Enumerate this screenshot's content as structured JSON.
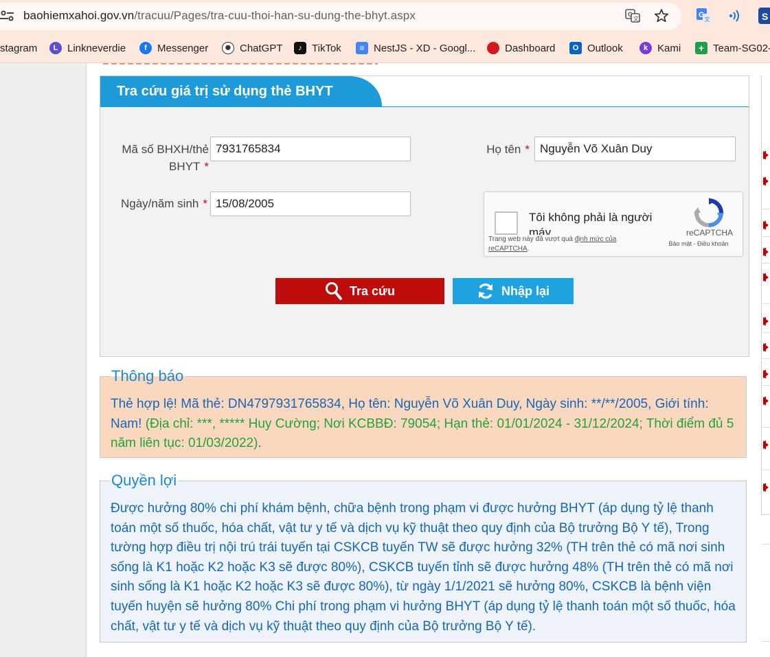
{
  "browser": {
    "url_host": "baohiemxahoi.gov.vn",
    "url_path": "/tracuu/Pages/tra-cuu-thoi-han-su-dung-the-bhyt.aspx",
    "icons": [
      "site-settings-icon",
      "translate-icon",
      "star-icon",
      "google-translate-extension-icon",
      "read-aloud-extension-icon",
      "extension-icon"
    ]
  },
  "bookmarks": [
    {
      "label": "stagram",
      "icon": "instagram-icon"
    },
    {
      "label": "Linkneverdie",
      "icon": "L"
    },
    {
      "label": "Messenger",
      "icon": "messenger-icon"
    },
    {
      "label": "ChatGPT",
      "icon": "chatgpt-icon"
    },
    {
      "label": "TikTok",
      "icon": "tiktok-icon"
    },
    {
      "label": "NestJS - XD - Googl...",
      "icon": "google-docs-icon"
    },
    {
      "label": "Dashboard",
      "icon": "dashboard-icon"
    },
    {
      "label": "Outlook",
      "icon": "outlook-icon"
    },
    {
      "label": "Kami",
      "icon": "k"
    },
    {
      "label": "Team-SG02-",
      "icon": "google-sheets-icon"
    }
  ],
  "form": {
    "title": "Tra cứu giá trị sử dụng thẻ BHYT",
    "card_label_1": "Mã số BHXH/thẻ",
    "card_label_2": "BHYT",
    "card_value": "7931765834",
    "name_label": "Họ tên",
    "name_value": "Nguyễn Võ Xuân Duy",
    "dob_label": "Ngày/năm sinh",
    "dob_value": "15/08/2005",
    "required_mark": "*",
    "search_button": "Tra cứu",
    "reset_button": "Nhập lại"
  },
  "captcha": {
    "label": "Tôi không phải là người máy",
    "notice_prefix": "Trang web này đã vượt quá",
    "notice_link": "định mức của reCAPTCHA",
    "notice_suffix": ".",
    "brand": "reCAPTCHA",
    "terms": "Bảo mật - Điều khoản"
  },
  "notice": {
    "legend": "Thông báo",
    "text_blue": "Thẻ hợp lệ! Mã thẻ: DN4797931765834, Họ tên: Nguyễn Võ Xuân Duy, Ngày sinh: **/**/2005, Giới tính: Nam!",
    "text_green": "(Địa chỉ: ***, ***** Huy Cường; Nơi KCBBĐ: 79054; Hạn thẻ: 01/01/2024 - 31/12/2024; Thời điểm đủ 5 năm liên tục: 01/03/2022)",
    "text_end": "."
  },
  "benefit": {
    "legend": "Quyền lợi",
    "text": "Được hưởng 80% chi phí khám bệnh, chữa bệnh trong phạm vi được hưởng BHYT (áp dụng tỷ lệ thanh toán một số thuốc, hóa chất, vật tư y tế và dịch vụ kỹ thuật theo quy định của Bộ trưởng Bộ Y tế), Trong tường hợp điều trị nội trú trái tuyến tại CSKCB tuyến TW sẽ được hưởng 32% (TH trên thẻ có mã nơi sinh sống là K1 hoặc K2 hoặc K3 sẽ được 80%), CSKCB tuyến tỉnh sẽ được hưởng 48% (TH trên thẻ có mã nơi sinh sống là K1 hoặc K2 hoặc K3 sẽ được 80%), từ ngày 1/1/2021 sẽ hưởng 80%, CSKCB là bệnh viện tuyến huyện sẽ hưởng 80% Chi phí trong phạm vi hưởng BHYT (áp dụng tỷ lệ thanh toán một số thuốc, hóa chất, vật tư y tế và dịch vụ kỹ thuật theo quy định của Bộ trưởng Bộ Y tế)."
  },
  "colors": {
    "accent_blue": "#1c9bd8",
    "search_red": "#bf0d0d",
    "notice_bg": "#fad8c0",
    "benefit_bg": "#edf3f8",
    "valid_green": "#21a336"
  }
}
